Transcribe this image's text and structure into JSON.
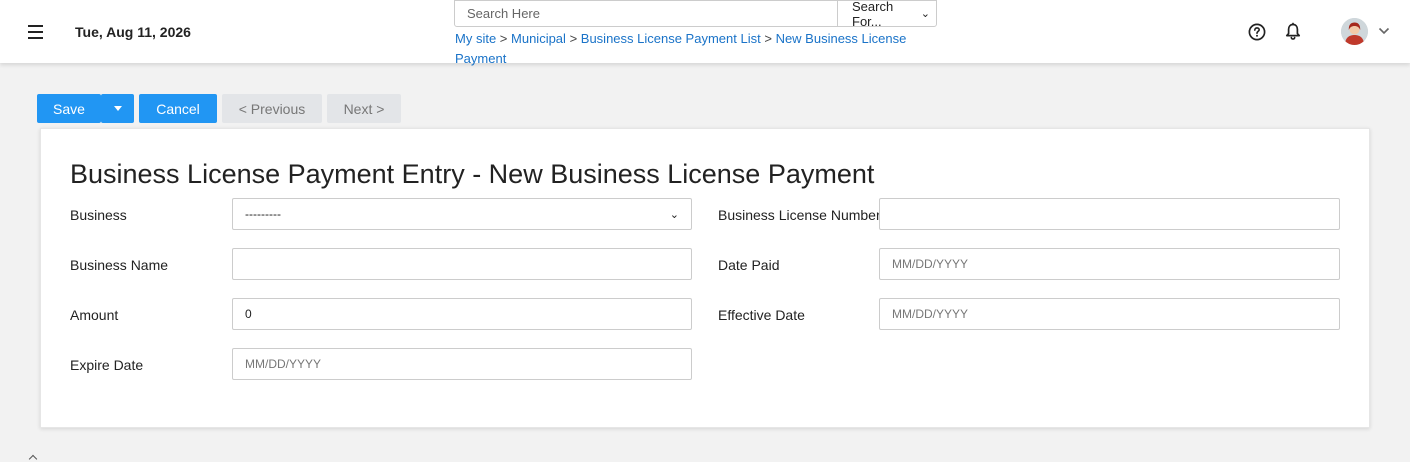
{
  "header": {
    "date": "Tue, Aug 11, 2026",
    "search": {
      "placeholder": "Search Here",
      "value": ""
    },
    "search_scope": "Search For...",
    "breadcrumb": {
      "items": [
        "My site",
        "Municipal",
        "Business License Payment List",
        "New Business License Payment"
      ],
      "separator": ">"
    },
    "icons": [
      "menu-icon",
      "help-icon",
      "bell-icon",
      "avatar",
      "chevron-down-icon"
    ]
  },
  "toolbar": {
    "save_label": "Save",
    "cancel_label": "Cancel",
    "previous_label": "< Previous",
    "next_label": "Next >"
  },
  "form": {
    "title": "Business License Payment Entry - New Business License Payment",
    "business": {
      "label": "Business",
      "value": "---------"
    },
    "business_name": {
      "label": "Business Name",
      "value": ""
    },
    "amount": {
      "label": "Amount",
      "value": "0"
    },
    "expire_date": {
      "label": "Expire Date",
      "placeholder": "MM/DD/YYYY"
    },
    "license_number": {
      "label": "Business License Number",
      "value": ""
    },
    "date_paid": {
      "label": "Date Paid",
      "placeholder": "MM/DD/YYYY"
    },
    "effective_date": {
      "label": "Effective Date",
      "placeholder": "MM/DD/YYYY"
    }
  },
  "colors": {
    "primary": "#2196f3",
    "link": "#1a73c8",
    "disabled_button": "#e3e5e8",
    "page_background": "#f2f2f2"
  }
}
